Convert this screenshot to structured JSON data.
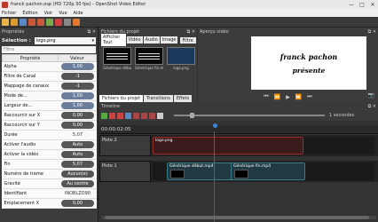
{
  "window": {
    "title": "franck pachon.osp (HD 720p 30 fps) - OpenShot Video Editor",
    "min": "—",
    "max": "□",
    "close": "✕"
  },
  "menu": [
    "Fichier",
    "Édition",
    "Voir",
    "Vue",
    "Aide"
  ],
  "props": {
    "title": "Propriétés",
    "selection_label": "Sélection :",
    "selection_value": "logo.png",
    "filter_placeholder": "Filtre",
    "col_prop": "Propriété",
    "col_val": "Valeur",
    "rows": [
      {
        "name": "Alpha",
        "value": "1,00",
        "style": "blue"
      },
      {
        "name": "Filtre de Canal",
        "value": "-1",
        "style": "dark"
      },
      {
        "name": "Mappage de canaux",
        "value": "-1",
        "style": "dark"
      },
      {
        "name": "Mode de...",
        "value": "1,00",
        "style": "blue"
      },
      {
        "name": "Largeur de...",
        "value": "1,00",
        "style": "blue"
      },
      {
        "name": "Raccourcir sur X",
        "value": "0,00",
        "style": "dark"
      },
      {
        "name": "Raccourcir sur Y",
        "value": "0,00",
        "style": "dark"
      },
      {
        "name": "Durée",
        "value": "5,07",
        "style": "plain"
      },
      {
        "name": "Activer l'audio",
        "value": "Auto",
        "style": "dark"
      },
      {
        "name": "Activer la vidéo",
        "value": "Auto",
        "style": "dark"
      },
      {
        "name": "Fin",
        "value": "5,07",
        "style": "dark"
      },
      {
        "name": "Numéro de trame",
        "value": "Aucun(e)",
        "style": "dark"
      },
      {
        "name": "Gravité",
        "value": "Au centre",
        "style": "dark"
      },
      {
        "name": "Identifiant",
        "value": "INOBLZO90",
        "style": "plain"
      },
      {
        "name": "Emplacement X",
        "value": "0,00",
        "style": "dark"
      }
    ]
  },
  "files": {
    "title": "Fichiers du projet",
    "tabs": [
      "Afficher Tout",
      "Vidéo",
      "Audio",
      "Image"
    ],
    "filter_placeholder": "Filtre",
    "items": [
      {
        "name": "Générique début..."
      },
      {
        "name": "Générique fin.mp4"
      },
      {
        "name": "logo.png"
      }
    ],
    "bottom_tabs": [
      "Fichiers du projet",
      "Transitions",
      "Effets"
    ]
  },
  "preview": {
    "title": "Aperçu vidéo",
    "line1": "franck pachon",
    "line2": "présente",
    "controls": [
      "⏮",
      "⏪",
      "▶",
      "⏩",
      "⏭"
    ],
    "camera": "📷"
  },
  "timeline": {
    "title": "Timeline",
    "timecode": "00:00:02:05",
    "zoom_label": "1 secondes",
    "tracks": [
      {
        "name": "Piste 2",
        "clips": [
          {
            "label": "logo.png"
          }
        ]
      },
      {
        "name": "Piste 1",
        "clips": [
          {
            "label": "Générique début.mp4"
          },
          {
            "label": "Générique fin.mp4"
          }
        ]
      }
    ]
  },
  "colors": {
    "accent": "#c0392b",
    "clip_red": "#9a2a2a",
    "clip_teal": "#3a7a8a",
    "playhead": "#3a86d6"
  }
}
